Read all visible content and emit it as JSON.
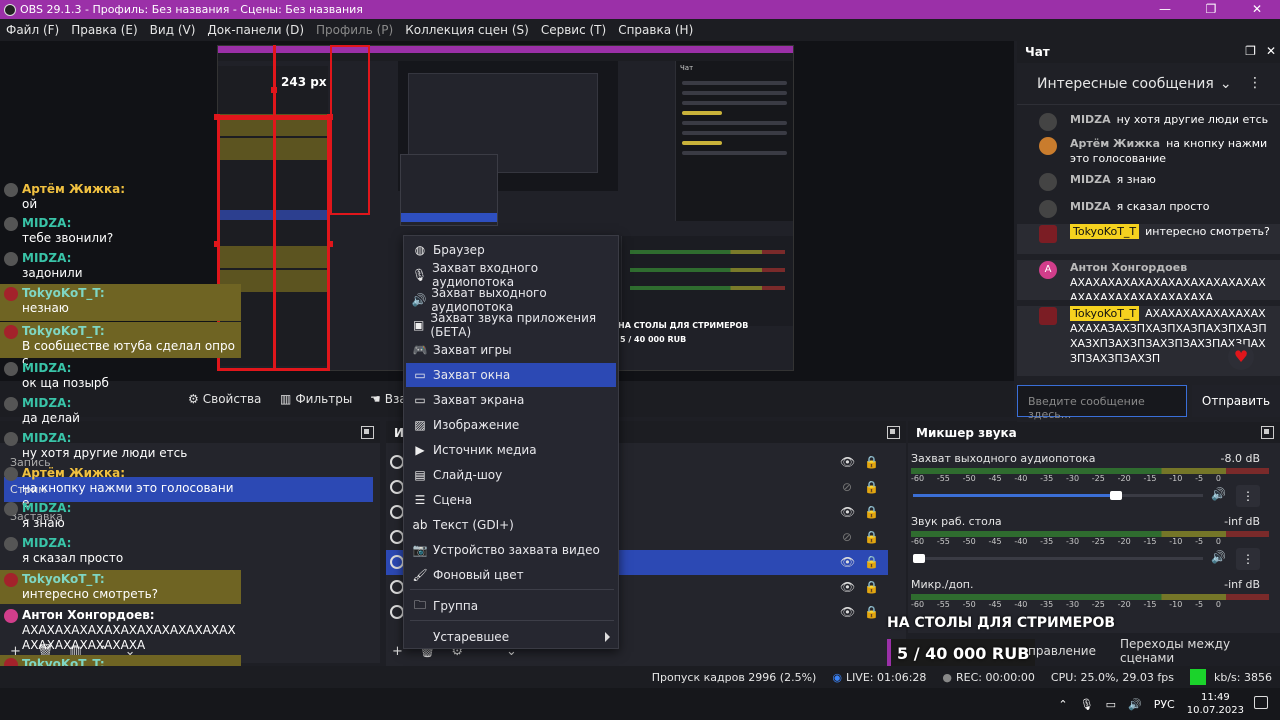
{
  "window": {
    "title": "OBS 29.1.3 - Профиль: Без названия - Сцены: Без названия",
    "controls": [
      "—",
      "❐",
      "✕"
    ]
  },
  "menu": [
    {
      "label": "Файл (F)",
      "disabled": false
    },
    {
      "label": "Правка (E)",
      "disabled": false
    },
    {
      "label": "Вид (V)",
      "disabled": false
    },
    {
      "label": "Док-панели (D)",
      "disabled": false
    },
    {
      "label": "Профиль (P)",
      "disabled": true
    },
    {
      "label": "Коллекция сцен (S)",
      "disabled": false
    },
    {
      "label": "Сервис (T)",
      "disabled": false
    },
    {
      "label": "Справка (H)",
      "disabled": false
    }
  ],
  "preview": {
    "measure_label": "243 px",
    "nested_live_title": "НА СТОЛЫ ДЛЯ СТРИМЕРОВ",
    "nested_goal": "5 / 40 000 RUB"
  },
  "preview_toolbar": {
    "properties": "Свойства",
    "filters": "Фильтры",
    "interact": "Взаи"
  },
  "docks": {
    "scenes_title": "",
    "sources_title": "Ис",
    "mixer_title": "Микшер звука",
    "scenes_partial": [
      "Запись",
      "Стрим",
      "Заставка"
    ]
  },
  "context_menu": {
    "items": [
      {
        "icon": "globe-icon",
        "glyph": "◍",
        "label": "Браузер"
      },
      {
        "icon": "mic-icon",
        "glyph": "🎙",
        "label": "Захват входного аудиопотока"
      },
      {
        "icon": "speaker-icon",
        "glyph": "🔊",
        "label": "Захват выходного аудиопотока"
      },
      {
        "icon": "app-audio-icon",
        "glyph": "▣",
        "label": "Захват звука приложения (БЕТА)"
      },
      {
        "icon": "gamepad-icon",
        "glyph": "🎮",
        "label": "Захват игры"
      },
      {
        "icon": "window-icon",
        "glyph": "▭",
        "label": "Захват окна"
      },
      {
        "icon": "monitor-icon",
        "glyph": "▭",
        "label": "Захват экрана"
      },
      {
        "icon": "image-icon",
        "glyph": "▨",
        "label": "Изображение"
      },
      {
        "icon": "play-icon",
        "glyph": "▶",
        "label": "Источник медиа"
      },
      {
        "icon": "slideshow-icon",
        "glyph": "▤",
        "label": "Слайд-шоу"
      },
      {
        "icon": "list-icon",
        "glyph": "☰",
        "label": "Сцена"
      },
      {
        "icon": "text-icon",
        "glyph": "ab",
        "label": "Текст (GDI+)"
      },
      {
        "icon": "camera-icon",
        "glyph": "📷",
        "label": "Устройство захвата видео"
      },
      {
        "icon": "brush-icon",
        "glyph": "🖌",
        "label": "Фоновый цвет"
      },
      {
        "icon": "folder-icon",
        "glyph": "🗀",
        "label": "Группа"
      },
      {
        "icon": "",
        "glyph": "",
        "label": "Устаревшее"
      }
    ],
    "selected_index": 5
  },
  "overlay_chat": [
    {
      "user": "Артём Жижка:",
      "text": "ой",
      "style": "o"
    },
    {
      "user": "MIDZA:",
      "text": "тебе звонили?",
      "style": "g"
    },
    {
      "user": "MIDZA:",
      "text": "задонили",
      "style": "g"
    },
    {
      "user": "TokyoKoT_T:",
      "text": "незнаю",
      "style": "t"
    },
    {
      "user": "TokyoKoT_T:",
      "text": "В сообществе ютуба сделал опрос",
      "style": "t"
    },
    {
      "user": "MIDZA:",
      "text": "ок ща позырб",
      "style": "g"
    },
    {
      "user": "MIDZA:",
      "text": "да делай",
      "style": "g"
    },
    {
      "user": "MIDZA:",
      "text": "ну хотя другие люди етсь",
      "style": "g"
    },
    {
      "user": "Артём Жижка:",
      "text": "на кнопку нажми это голосование",
      "style": "o"
    },
    {
      "user": "MIDZA:",
      "text": "я знаю",
      "style": "g"
    },
    {
      "user": "MIDZA:",
      "text": "я сказал просто",
      "style": "g"
    },
    {
      "user": "TokyoKoT_T:",
      "text": "интересно смотреть?",
      "style": "t"
    },
    {
      "user": "Антон Хонгордоев:",
      "text": "АХАХАХАХАХАХАХАХАХАХАХАХАХАХАХАХАХАХАХАХА",
      "style": "w"
    },
    {
      "user": "TokyoKoT_T:",
      "text": "АХАХАХАХАХАХАХАХАХАЗАХЗПХАЗХПАХЗПАХЗХПЗАХЗПЗАХЗПЗАХЗПЗАХЗПЗАХЗПЗАХЗПЗАХЗП",
      "style": "t"
    }
  ],
  "chat": {
    "title": "Чат",
    "filter": "Интересные сообщения",
    "messages": [
      {
        "user": "MIDZA",
        "text": "ну хотя другие люди етсь"
      },
      {
        "user": "Артём Жижка",
        "text": "на кнопку нажми это голосование"
      },
      {
        "user": "MIDZA",
        "text": "я знаю"
      },
      {
        "user": "MIDZA",
        "text": "я сказал просто"
      },
      {
        "user": "TokyoKoT_T",
        "text": "интересно смотреть?"
      },
      {
        "user": "Антон Хонгордоев",
        "text": "АХАХАХАХАХАХАХАХАХАХАХАХАХАХАХАХАХАХАХАХАХАХА"
      },
      {
        "user": "TokyoKoT_T",
        "text": "АХАХАХАХАХАХАХАХАХАХАЗАХЗПХАЗПХАЗПАХЗПХАЗПХАЗХПЗАХЗПЗАХЗПЗАХЗПАХЗПАХЗПЗАХЗПЗАХЗП"
      }
    ],
    "input_placeholder": "Введите сообщение здесь...",
    "send_label": "Отправить"
  },
  "mixer": [
    {
      "name": "Захват выходного аудиопотока",
      "db": "-8.0 dB",
      "volume": 0.7
    },
    {
      "name": "Звук раб. стола",
      "db": "-inf dB",
      "volume": 0.0
    },
    {
      "name": "Микр./доп.",
      "db": "-inf dB",
      "volume": 0.0
    }
  ],
  "mixer_ticks": [
    "-60",
    "-55",
    "-50",
    "-45",
    "-40",
    "-35",
    "-30",
    "-25",
    "-20",
    "-15",
    "-10",
    "-5",
    "0"
  ],
  "stream_overlay": {
    "title": "НА СТОЛЫ ДЛЯ СТРИМЕРОВ",
    "goal": "5 / 40 000 RUB"
  },
  "transitions": {
    "control_partial": "правление",
    "scene_transitions": "Переходы между сценами"
  },
  "status": {
    "dropped_frames": "Пропуск кадров 2996 (2.5%)",
    "live": "LIVE: 01:06:28",
    "rec": "REC: 00:00:00",
    "cpu": "CPU: 25.0%, 29.03 fps",
    "bitrate": "kb/s: 3856"
  },
  "taskbar": {
    "lang": "РУС",
    "time": "11:49",
    "date": "10.07.2023"
  },
  "colors": {
    "titlebar": "#9b30a8",
    "selection": "#2c49b4",
    "measure_red": "#e0161b",
    "highlight_yellow": "#f5d21f",
    "status_green": "#1bd32b"
  }
}
